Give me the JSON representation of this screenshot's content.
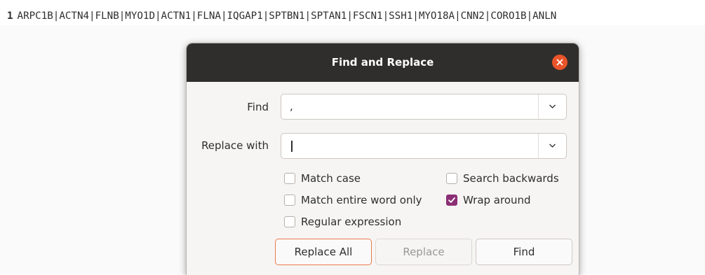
{
  "editor": {
    "line_number": "1",
    "line_text": "ARPC1B|ACTN4|FLNB|MYO1D|ACTN1|FLNA|IQGAP1|SPTBN1|SPTAN1|FSCN1|SSH1|MYO18A|CNN2|CORO1B|ANLN"
  },
  "dialog": {
    "title": "Find and Replace",
    "close_icon": "close-icon",
    "find_label": "Find",
    "find_value": ",",
    "replace_label": "Replace with",
    "replace_value": "",
    "dropdown_icon": "chevron-down-icon",
    "options": {
      "match_case": {
        "label": "Match case",
        "checked": false
      },
      "match_entire_word": {
        "label": "Match entire word only",
        "checked": false
      },
      "regular_expression": {
        "label": "Regular expression",
        "checked": false
      },
      "search_backwards": {
        "label": "Search backwards",
        "checked": false
      },
      "wrap_around": {
        "label": "Wrap around",
        "checked": true
      }
    },
    "buttons": {
      "replace_all": "Replace All",
      "replace": "Replace",
      "find": "Find"
    }
  },
  "colors": {
    "titlebar": "#302e2c",
    "close_button": "#e9542a",
    "checkbox_checked": "#8b2e74",
    "default_button_border": "#e9794c"
  }
}
